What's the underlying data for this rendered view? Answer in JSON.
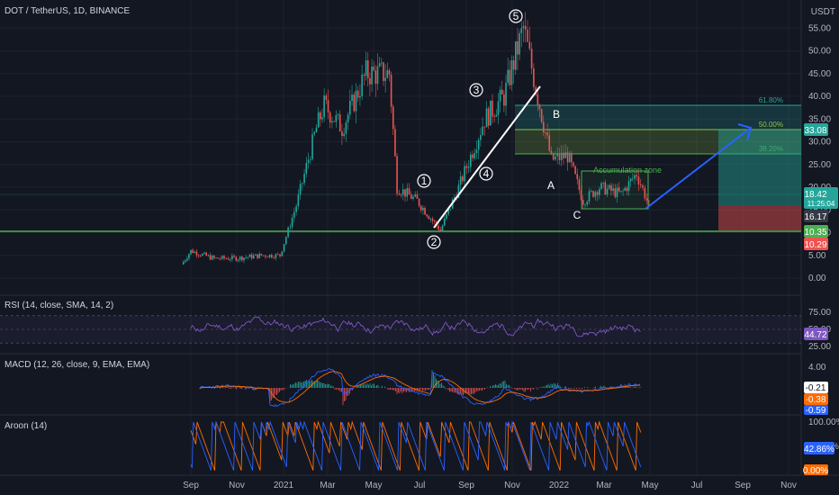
{
  "title": "DOT / TetherUS, 1D, BINANCE",
  "currency": "USDT",
  "price_axis_ticks": [
    "55.00",
    "50.00",
    "45.00",
    "40.00",
    "35.00",
    "30.00",
    "25.00",
    "20.00",
    "15.00",
    "10.00",
    "5.00",
    "0.00"
  ],
  "time_axis_labels": [
    "Sep",
    "Nov",
    "2021",
    "Mar",
    "May",
    "Jul",
    "Sep",
    "Nov",
    "2022",
    "Mar",
    "May",
    "Jul",
    "Sep",
    "Nov"
  ],
  "price_badges": {
    "target": "33.08",
    "last": "18.42",
    "countdown": "11:25:04",
    "low": "16.17",
    "support": "10.35",
    "stop": "10.29"
  },
  "fib_labels": {
    "f618": "61.80%",
    "f50": "50.00%",
    "f382": "38.20%"
  },
  "wave_labels": [
    "1",
    "2",
    "3",
    "4",
    "5"
  ],
  "abc_labels": [
    "A",
    "B",
    "C"
  ],
  "accumulation_label": "Accumulation zone",
  "rsi": {
    "title": "RSI (14, close, SMA, 14, 2)",
    "ticks": [
      "75.00",
      "50.00",
      "25.00"
    ],
    "value": "44.72"
  },
  "macd": {
    "title": "MACD (12, 26, close, 9, EMA, EMA)",
    "ticks": [
      "4.00",
      "0.00"
    ],
    "values": [
      "-0.21",
      "-0.38",
      "-0.59"
    ]
  },
  "aroon": {
    "title": "Aroon (14)",
    "ticks": [
      "100.00%",
      "50.00%"
    ],
    "values": [
      "42.86%",
      "0.00%"
    ]
  },
  "colors": {
    "bg": "#131722",
    "up": "#26a69a",
    "down": "#ef5350",
    "support": "#4caf50",
    "rsi": "#7e57c2",
    "macd": "#2962ff",
    "signal": "#ff6d00",
    "aroon_up": "#ff6d00",
    "aroon_down": "#2962ff",
    "arrow": "#2962ff"
  },
  "chart_data": {
    "type": "line",
    "title": "DOT / TetherUS, 1D, BINANCE",
    "xlabel": "",
    "ylabel": "",
    "ylim": [
      0,
      57
    ],
    "series": [
      {
        "name": "DOT / TetherUS",
        "x": [
          "2020-08-20",
          "2020-09-01",
          "2020-10-01",
          "2020-11-01",
          "2020-12-01",
          "2020-12-25",
          "2021-01-15",
          "2021-02-10",
          "2021-02-20",
          "2021-03-15",
          "2021-04-15",
          "2021-05-15",
          "2021-05-25",
          "2021-06-20",
          "2021-07-20",
          "2021-08-15",
          "2021-09-15",
          "2021-10-10",
          "2021-11-04",
          "2021-11-20",
          "2021-12-10",
          "2021-12-31",
          "2022-01-20",
          "2022-02-10",
          "2022-03-10",
          "2022-03-30",
          "2022-04-15"
        ],
        "values": [
          3.0,
          6.0,
          4.3,
          4.4,
          5.0,
          5.0,
          16.0,
          33.0,
          38.0,
          33.0,
          45.0,
          45.0,
          20.0,
          17.0,
          10.5,
          21.0,
          35.0,
          40.0,
          55.0,
          42.0,
          26.0,
          27.0,
          17.0,
          20.0,
          18.5,
          23.0,
          16.0
        ]
      }
    ],
    "annotations": {
      "accumulation_zone": [
        15.5,
        23.5
      ],
      "support_line": 10.35,
      "fibonacci": {
        "61.80%": 38.2,
        "50.00%": 33.08,
        "38.20%": 28.0
      },
      "target": 33.08,
      "stop": 10.29
    }
  }
}
